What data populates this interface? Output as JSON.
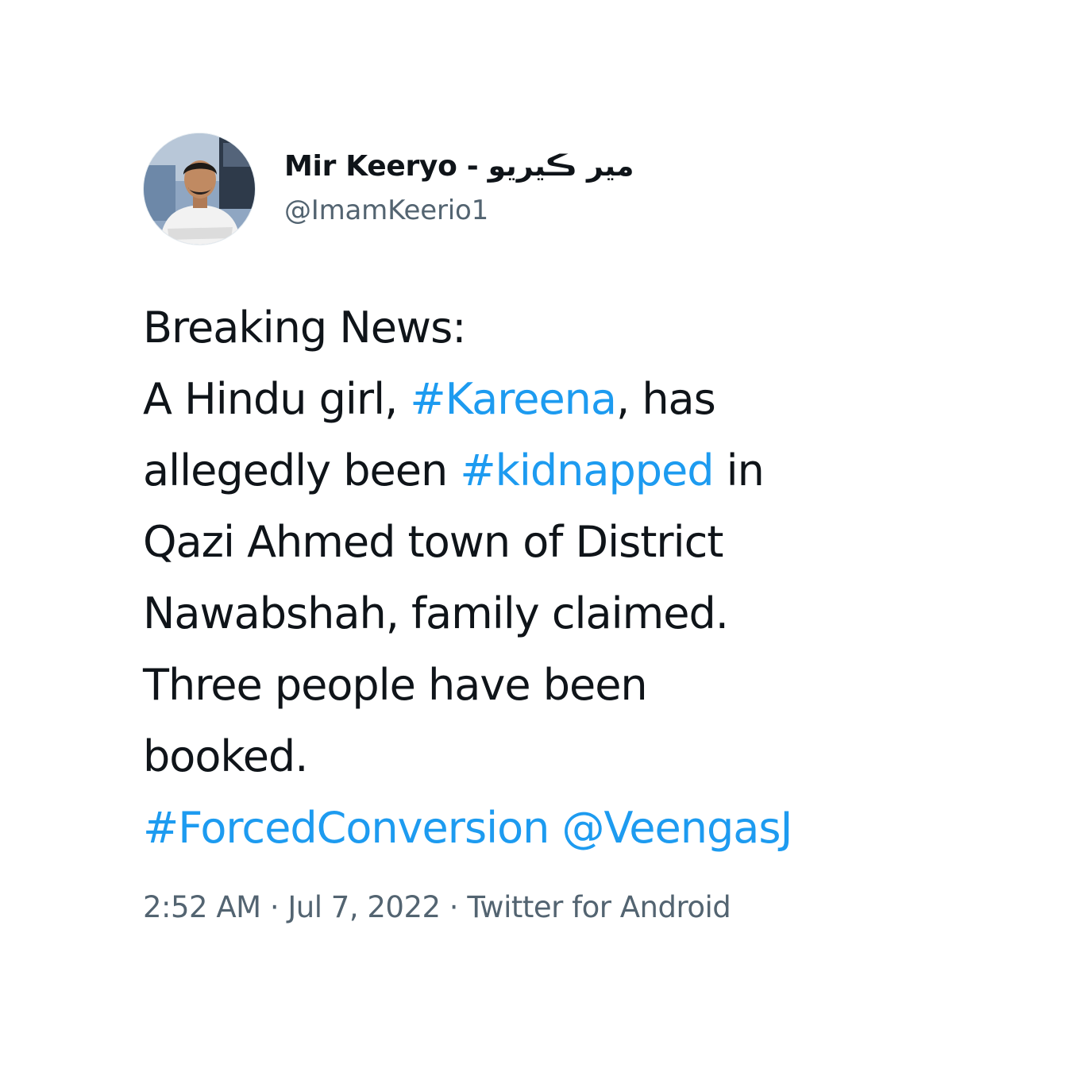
{
  "author": {
    "display_name": "Mir Keeryo - مير ڪيريو",
    "handle": "@ImamKeerio1",
    "avatar_alt": "profile photo"
  },
  "tweet": {
    "lines": [
      [
        {
          "text": "Breaking News:",
          "link": false
        }
      ],
      [
        {
          "text": "A Hindu girl, ",
          "link": false
        },
        {
          "text": "#Kareena",
          "link": true
        },
        {
          "text": ", has",
          "link": false
        }
      ],
      [
        {
          "text": "allegedly been ",
          "link": false
        },
        {
          "text": "#kidnapped",
          "link": true
        },
        {
          "text": " in",
          "link": false
        }
      ],
      [
        {
          "text": "Qazi Ahmed town of District",
          "link": false
        }
      ],
      [
        {
          "text": "Nawabshah, family claimed.",
          "link": false
        }
      ],
      [
        {
          "text": "Three people have been",
          "link": false
        }
      ],
      [
        {
          "text": "booked.",
          "link": false
        }
      ],
      [
        {
          "text": "#ForcedConversion",
          "link": true
        },
        {
          "text": " ",
          "link": false
        },
        {
          "text": "@VeengasJ",
          "link": true
        }
      ]
    ]
  },
  "meta": {
    "time": "2:52 AM",
    "separator": " · ",
    "date": "Jul 7, 2022",
    "source": "Twitter for Android"
  },
  "colors": {
    "link": "#1d9bf0",
    "text": "#0f1419",
    "secondary": "#536471"
  }
}
